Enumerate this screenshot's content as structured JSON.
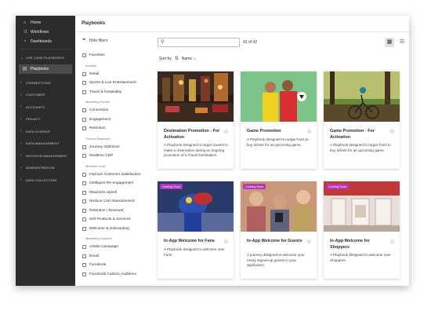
{
  "sidebar": {
    "top_items": [
      {
        "label": "Home",
        "icon": "home-icon"
      },
      {
        "label": "Workflows",
        "icon": "workflow-icon"
      },
      {
        "label": "Dashboards",
        "icon": "dashboard-icon"
      }
    ],
    "use_case_section": "USE CASE PLAYBOOKS",
    "active_item": "Playbooks",
    "sections": [
      "CONNECTIONS",
      "CUSTOMER",
      "ACCOUNTS",
      "PRIVACY",
      "DATA SCIENCE",
      "DATA MANAGEMENT",
      "DECISION MANAGEMENT",
      "ADMINISTRATION",
      "DATA COLLECTION"
    ]
  },
  "header": {
    "title": "Playbooks"
  },
  "filters": {
    "hide_label": "Hide filters",
    "favorites": "Favorites",
    "groups": [
      {
        "title": "Industry",
        "options": [
          "Retail",
          "Sports & Live Entertainment",
          "Travel & Hospitality"
        ]
      },
      {
        "title": "Marketing Funnel",
        "options": [
          "Conversion",
          "Engagement",
          "Retention"
        ]
      },
      {
        "title": "Product Required",
        "options": [
          "Journey Optimizer",
          "Realtime CDP"
        ]
      },
      {
        "title": "Marketer Goal",
        "options": [
          "Improve Customer Satisfaction",
          "Intelligent Re-engagement",
          "Maximize Upsell",
          "Reduce Cart Abandonment",
          "Retention / Renewal",
          "Sell Products & Services",
          "Welcome & Onboarding"
        ]
      },
      {
        "title": "Marketing Channel",
        "options": [
          "Adobe Campaign",
          "Email",
          "Facebook",
          "Facebook Custom Audience"
        ]
      }
    ]
  },
  "toolbar": {
    "search_placeholder": "",
    "count": "42 of 42",
    "sort_label": "Sort by",
    "sort_value": "Name"
  },
  "cards": [
    {
      "title": "Destination Promotion - For Activation",
      "description": "A Playbook designed to target Guests to make a reservation during an ongoing promotion of a Travel Destination.",
      "badge": ""
    },
    {
      "title": "Game Promotion",
      "description": "A Playbook designed to nudge Fans to buy tickets for an upcoming game.",
      "badge": ""
    },
    {
      "title": "Game Promotion - For Activation",
      "description": "A Playbook designed to target Fans to buy tickets for an upcoming game.",
      "badge": ""
    },
    {
      "title": "In-App Welcome for Fans",
      "description": "A Playbook designed to welcome new Fans.",
      "badge": "Coming Soon"
    },
    {
      "title": "In-App Welcome for Guests",
      "description": "A journey designed to welcome your newly signed-up guests in your application.",
      "badge": "Coming Soon"
    },
    {
      "title": "In-App Welcome for Shoppers",
      "description": "A Playbook designed to welcome new Shoppers.",
      "badge": "Coming Soon"
    }
  ],
  "colors": {
    "sidebar_bg": "#2c2c2c",
    "badge": "#b13ab4",
    "accent": "#2c2c2c"
  }
}
